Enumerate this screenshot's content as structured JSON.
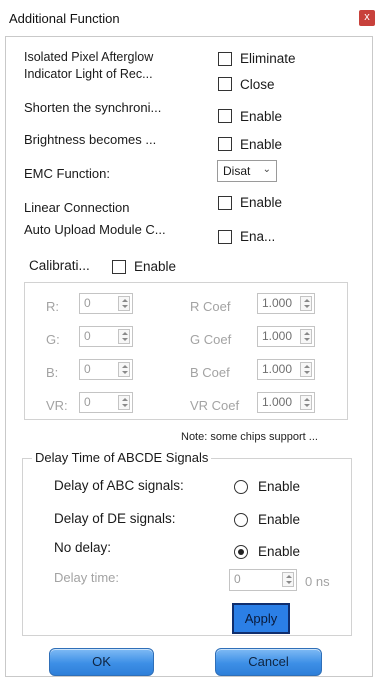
{
  "window": {
    "title": "Additional Function",
    "close_glyph": "x"
  },
  "settings": [
    {
      "label": "Isolated Pixel Afterglow",
      "option": "Eliminate"
    },
    {
      "label": "Indicator Light of Rec...",
      "option": "Close"
    },
    {
      "label": "Shorten the synchroni...",
      "option": "Enable"
    },
    {
      "label": "Brightness becomes ...",
      "option": "Enable"
    },
    {
      "label": "EMC Function:",
      "select_value": "Disat"
    },
    {
      "label": "Linear Connection",
      "option": "Enable"
    },
    {
      "label": "Auto Upload Module C...",
      "option": "Ena..."
    }
  ],
  "calibration": {
    "label": "Calibrati...",
    "option": "Enable",
    "rows": [
      {
        "label": "R:",
        "value": "0",
        "coef_label": "R Coef",
        "coef_value": "1.000"
      },
      {
        "label": "G:",
        "value": "0",
        "coef_label": "G Coef",
        "coef_value": "1.000"
      },
      {
        "label": "B:",
        "value": "0",
        "coef_label": "B Coef",
        "coef_value": "1.000"
      },
      {
        "label": "VR:",
        "value": "0",
        "coef_label": "VR Coef",
        "coef_value": "1.000"
      }
    ],
    "note": "Note: some chips support ..."
  },
  "delay": {
    "legend": "Delay Time of ABCDE Signals",
    "options": [
      {
        "label": "Delay of ABC signals:",
        "option": "Enable",
        "selected": false
      },
      {
        "label": "Delay of DE signals:",
        "option": "Enable",
        "selected": false
      },
      {
        "label": "No delay:",
        "option": "Enable",
        "selected": true
      }
    ],
    "delay_time_label": "Delay time:",
    "delay_time_value": "0",
    "delay_unit": "0 ns",
    "apply_label": "Apply"
  },
  "footer": {
    "ok_label": "OK",
    "cancel_label": "Cancel"
  },
  "colors": {
    "accent": "#2b7fe6",
    "close": "#c8413b"
  }
}
